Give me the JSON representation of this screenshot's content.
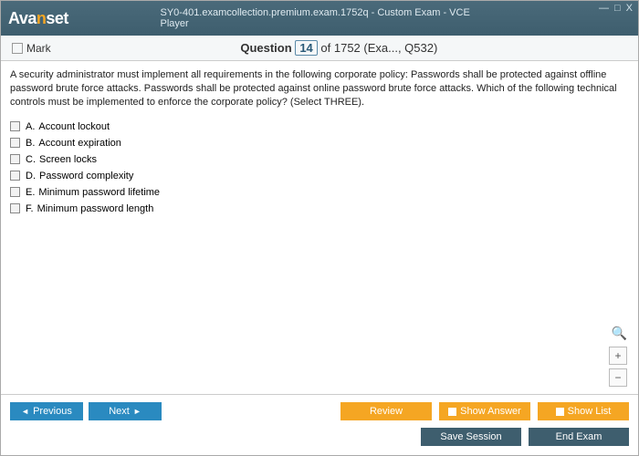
{
  "title": "SY0-401.examcollection.premium.exam.1752q - Custom Exam - VCE Player",
  "logo": {
    "pre": "Ava",
    "mid": "n",
    "post": "set"
  },
  "win": {
    "min": "—",
    "max": "□",
    "close": "X"
  },
  "mark_label": "Mark",
  "question_label": "Question",
  "question_num": "14",
  "question_suffix": "of 1752 (Exa..., Q532)",
  "question_text": "A security administrator must implement all requirements in the following corporate policy: Passwords shall be protected against offline password brute force attacks. Passwords shall be protected against online password brute force attacks. Which of the following technical controls must be implemented to enforce the corporate policy? (Select THREE).",
  "options": [
    {
      "letter": "A.",
      "text": "Account lockout"
    },
    {
      "letter": "B.",
      "text": "Account expiration"
    },
    {
      "letter": "C.",
      "text": "Screen locks"
    },
    {
      "letter": "D.",
      "text": "Password complexity"
    },
    {
      "letter": "E.",
      "text": "Minimum password lifetime"
    },
    {
      "letter": "F.",
      "text": "Minimum password length"
    }
  ],
  "zoom": {
    "plus": "+",
    "minus": "−",
    "mag": "🔍"
  },
  "buttons": {
    "previous": "Previous",
    "next": "Next",
    "review": "Review",
    "show_answer": "Show Answer",
    "show_list": "Show List",
    "save_session": "Save Session",
    "end_exam": "End Exam"
  }
}
